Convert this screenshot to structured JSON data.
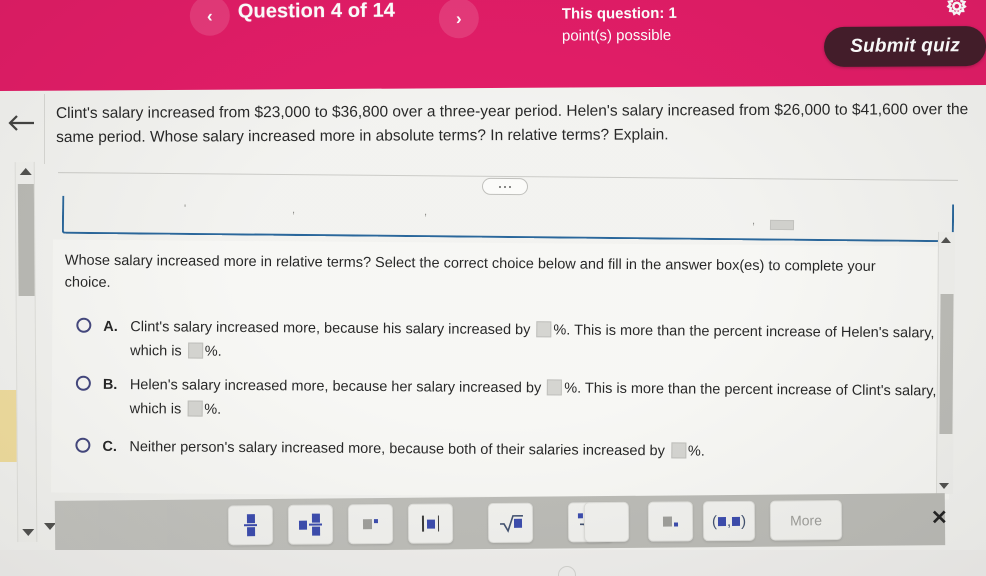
{
  "header": {
    "prev_label": "‹",
    "next_label": "›",
    "question_title": "Question 4 of 14",
    "points_line1": "possible",
    "points_line2": "This question: 1",
    "points_line3": "point(s) possible",
    "submit_label": "Submit quiz",
    "gear_icon": "gear-icon",
    "background_color": "#e0115f",
    "submit_color": "#3b1220"
  },
  "question": {
    "back_icon": "back-arrow-icon",
    "stem": "Clint's salary increased from $23,000 to $36,800 over a three-year period. Helen's salary increased from $26,000 to $41,600 over the same period. Whose salary increased more in absolute terms? In relative terms? Explain.",
    "overflow_icon": "ellipsis-icon"
  },
  "answers": {
    "prompt": "Whose salary increased more in relative terms? Select the correct choice below and fill in the answer box(es) to complete your choice.",
    "choices": [
      {
        "letter": "A.",
        "part1": "Clint's salary increased more, because his salary increased by",
        "part2": "%. This is more than the percent increase of Helen's salary, which is",
        "part3": "%.",
        "value1": "",
        "value2": "",
        "selected": false
      },
      {
        "letter": "B.",
        "part1": "Helen's salary increased more, because her salary increased by",
        "part2": "%. This is more than the percent increase of Clint's salary, which is",
        "part3": "%.",
        "value1": "",
        "value2": "",
        "selected": false
      },
      {
        "letter": "C.",
        "part1": "Neither person's salary increased more, because both of their salaries increased by",
        "part2": "%.",
        "part3": "",
        "value1": "",
        "value2": "",
        "selected": false
      }
    ]
  },
  "math_toolbar": {
    "buttons": [
      {
        "name": "fraction",
        "label": "■/■"
      },
      {
        "name": "mixed-number",
        "label": "■ ■/■"
      },
      {
        "name": "exponent",
        "label": "■·"
      },
      {
        "name": "absolute-value",
        "label": "|■|"
      },
      {
        "name": "square-root",
        "label": "√■"
      },
      {
        "name": "nth-root",
        "label": "ⁿ√■"
      },
      {
        "name": "subscript",
        "label": "■ₓ"
      },
      {
        "name": "ordered-pair",
        "label": "(■,■)"
      }
    ],
    "more_label": "More",
    "close_label": "✕"
  },
  "scrollbars": {
    "outer_left": "vertical-scrollbar",
    "inner_right": "vertical-scrollbar"
  }
}
